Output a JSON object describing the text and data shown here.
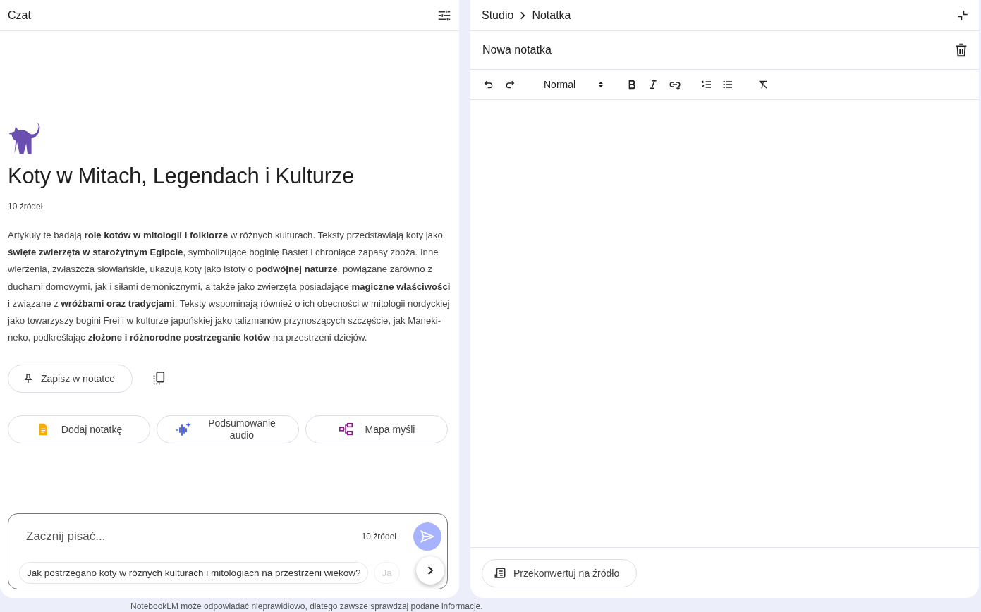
{
  "chat": {
    "title": "Czat",
    "notebook_title": "Koty w Mitach, Legendach i Kulturze",
    "source_count": "10 źródeł",
    "summary": "Artykuły te badają **rolę kotów w mitologii i folklorze** w różnych kulturach. Teksty przedstawiają koty jako **święte zwierzęta w starożytnym Egipcie**, symbolizujące boginię Bastet i chroniące zapasy zboża. Inne wierzenia, zwłaszcza słowiańskie, ukazują koty jako istoty o **podwójnej naturze**, powiązane zarówno z duchami domowymi, jak i siłami demonicznymi, a także jako zwierzęta posiadające **magiczne właściwości** i związane z **wróżbami oraz tradycjami**. Teksty wspominają również o ich obecności w mitologii nordyckiej jako towarzyszy bogini Frei i w kulturze japońskiej jako talizmanów przynoszących szczęście, jak Maneki-neko, podkreślając **złożone i różnorodne postrzeganie kotów** na przestrzeni dziejów.",
    "save_button": "Zapisz w notatce",
    "actions": [
      {
        "kind": "note",
        "label": "Dodaj notatkę"
      },
      {
        "kind": "audio",
        "label": "Podsumowanie audio"
      },
      {
        "kind": "mindmap",
        "label": "Mapa myśli"
      }
    ],
    "input": {
      "placeholder": "Zacznij pisać...",
      "source_count": "10 źródeł"
    },
    "suggestions": [
      "Jak postrzegano koty w różnych kulturach i mitologiach na przestrzeni wieków?",
      "Ja"
    ]
  },
  "studio": {
    "breadcrumb": [
      "Studio",
      "Notatka"
    ],
    "note_title": "Nowa notatka",
    "format": "Normal",
    "convert_button": "Przekonwertuj na źródło"
  },
  "footer": "NotebookLM może odpowiadać nieprawidłowo, dlatego zawsze sprawdzaj podane informacje."
}
